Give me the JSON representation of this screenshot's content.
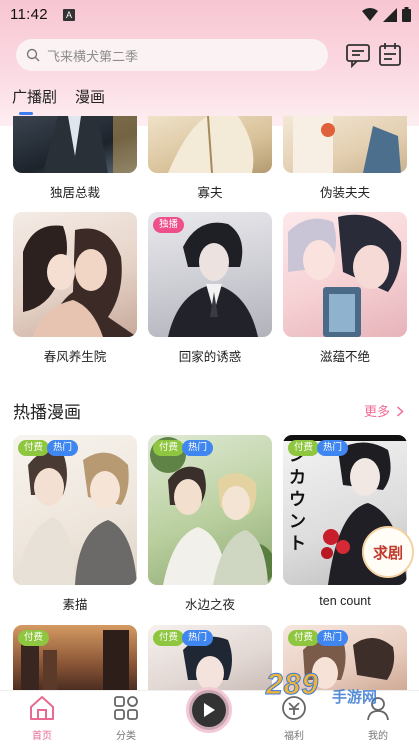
{
  "status": {
    "time": "11:42",
    "notif": "A"
  },
  "search": {
    "placeholder": "飞来横犬第二季"
  },
  "tabs": [
    {
      "label": "广播剧",
      "active": true
    },
    {
      "label": "漫画",
      "active": false
    }
  ],
  "radio_row1": [
    {
      "title": "独居总裁"
    },
    {
      "title": "寡夫"
    },
    {
      "title": "伪装夫夫"
    }
  ],
  "radio_row2": [
    {
      "title": "春风养生院",
      "badge": ""
    },
    {
      "title": "回家的诱惑",
      "badge": "独播"
    },
    {
      "title": "滋蕴不绝",
      "badge": ""
    }
  ],
  "comic_section": {
    "title": "热播漫画",
    "more": "更多"
  },
  "comic_row1": [
    {
      "title": "素描",
      "badge_paid": "付费",
      "badge_hot": "热门"
    },
    {
      "title": "水边之夜",
      "badge_paid": "付费",
      "badge_hot": "热门"
    },
    {
      "title": "ten count",
      "badge_paid": "付费",
      "badge_hot": "热门",
      "cover_text": "ンカウント"
    }
  ],
  "comic_row2": [
    {
      "badge_paid": "付费"
    },
    {
      "badge_paid": "付费",
      "badge_hot": "热门"
    },
    {
      "badge_paid": "付费",
      "badge_hot": "热门"
    }
  ],
  "floating": {
    "label": "求剧"
  },
  "watermark": {
    "text": "289",
    "sub": "手游网"
  },
  "bottom_nav": [
    {
      "label": "首页",
      "icon": "home-icon",
      "active": true
    },
    {
      "label": "分类",
      "icon": "grid-icon"
    },
    {
      "label": "福利",
      "icon": "gift-icon"
    },
    {
      "label": "我的",
      "icon": "user-icon"
    }
  ],
  "colors": {
    "accent_pink": "#f06c94",
    "tab_indicator": "#3d7df0",
    "badge_paid": "#8ec63f",
    "badge_hot": "#3f86f0",
    "badge_exclusive": "#ee4f8a"
  }
}
